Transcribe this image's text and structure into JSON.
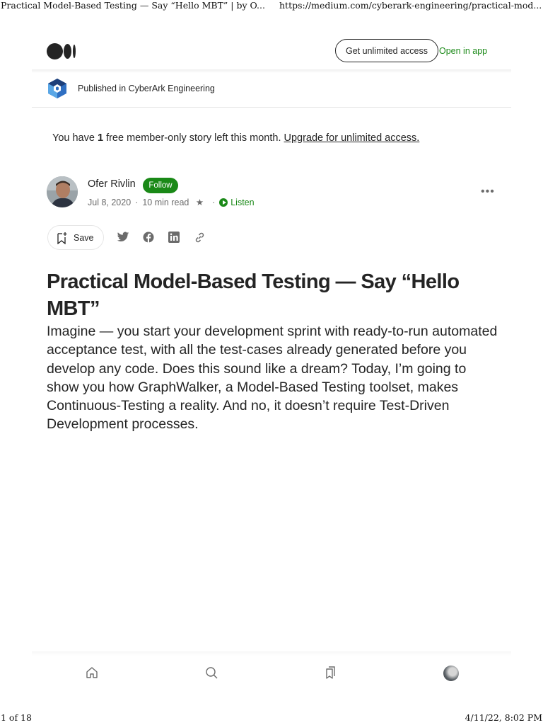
{
  "print_header": {
    "title": "Practical Model-Based Testing — Say “Hello MBT” | by O...",
    "url": "https://medium.com/cyberark-engineering/practical-mod..."
  },
  "print_footer": {
    "page": "1 of 18",
    "datetime": "4/11/22, 8:02 PM"
  },
  "topbar": {
    "get_unlimited_label": "Get unlimited access",
    "open_in_app_label": "Open in app"
  },
  "publication": {
    "label": "Published in CyberArk Engineering"
  },
  "notice": {
    "prefix": "You have ",
    "count": "1",
    "middle": " free member-only story left this month. ",
    "link": "Upgrade for unlimited access."
  },
  "author": {
    "name": "Ofer Rivlin",
    "follow_label": "Follow",
    "date": "Jul 8, 2020",
    "read_time": "10 min read",
    "star": "★",
    "listen_label": "Listen",
    "more": "•••"
  },
  "actions": {
    "save_label": "Save"
  },
  "article": {
    "title": "Practical Model-Based Testing — Say “Hello MBT”",
    "body": "Imagine — you start your development sprint with ready-to-run automated acceptance test, with all the test-cases already generated before you develop any code. Does this sound like a dream? Today, I’m going to show you how GraphWalker, a Model-Based Testing toolset, makes Continuous-Testing a reality. And no, it doesn’t require Test-Driven Development processes."
  },
  "colors": {
    "accent_green": "#1a8917",
    "text": "#242424",
    "muted": "#6b6b6b"
  }
}
